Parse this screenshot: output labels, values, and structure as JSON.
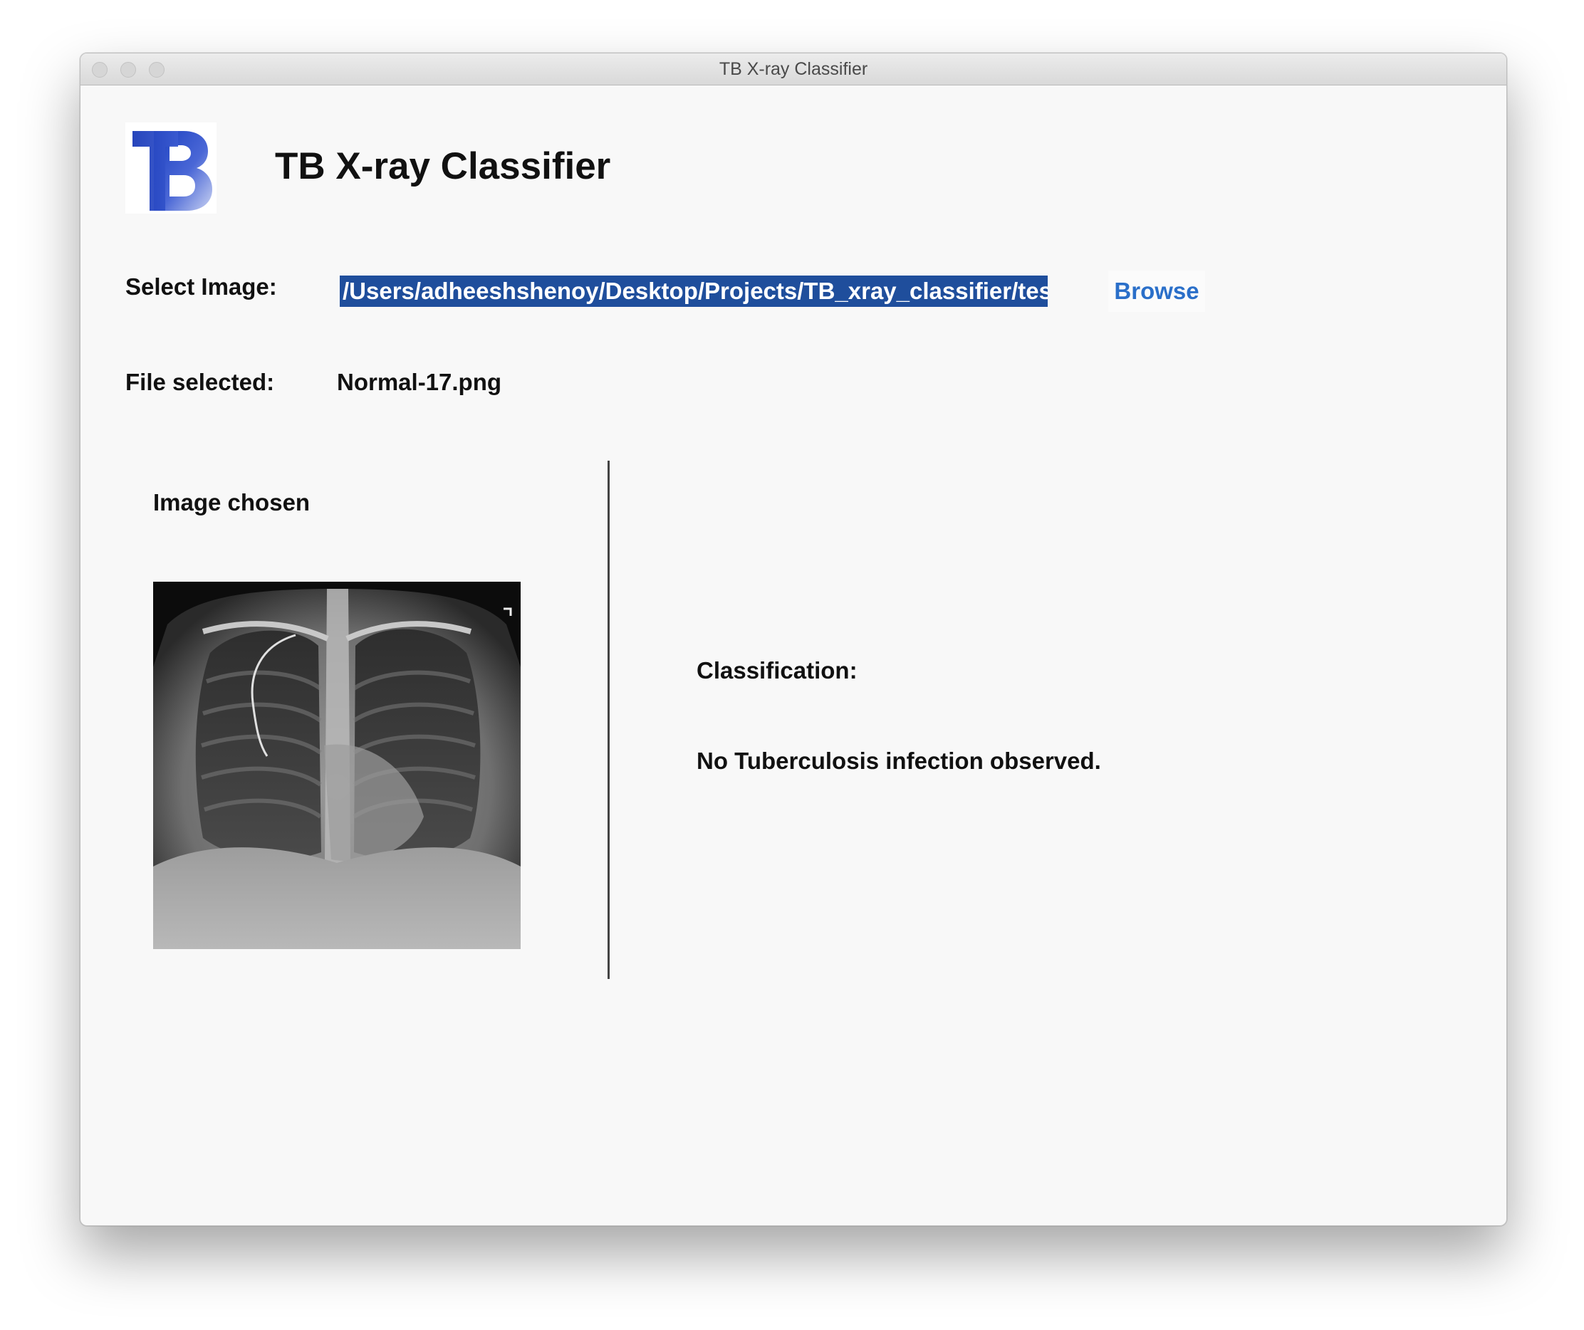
{
  "window": {
    "title": "TB X-ray Classifier"
  },
  "app": {
    "title": "TB X-ray Classifier",
    "logo_icon": "tb-logo-icon",
    "logo_text": "TB"
  },
  "select": {
    "label": "Select Image:",
    "path_value": "/Users/adheeshshenoy/Desktop/Projects/TB_xray_classifier/tes",
    "browse_label": "Browse"
  },
  "file": {
    "label": "File selected:",
    "name": "Normal-17.png"
  },
  "preview": {
    "heading": "Image chosen",
    "image_icon": "chest-xray-image"
  },
  "result": {
    "label": "Classification:",
    "text": "No Tuberculosis infection observed."
  },
  "colors": {
    "accent": "#2a6fc9",
    "selection": "#1f4e9c",
    "window_bg": "#f8f8f8"
  }
}
